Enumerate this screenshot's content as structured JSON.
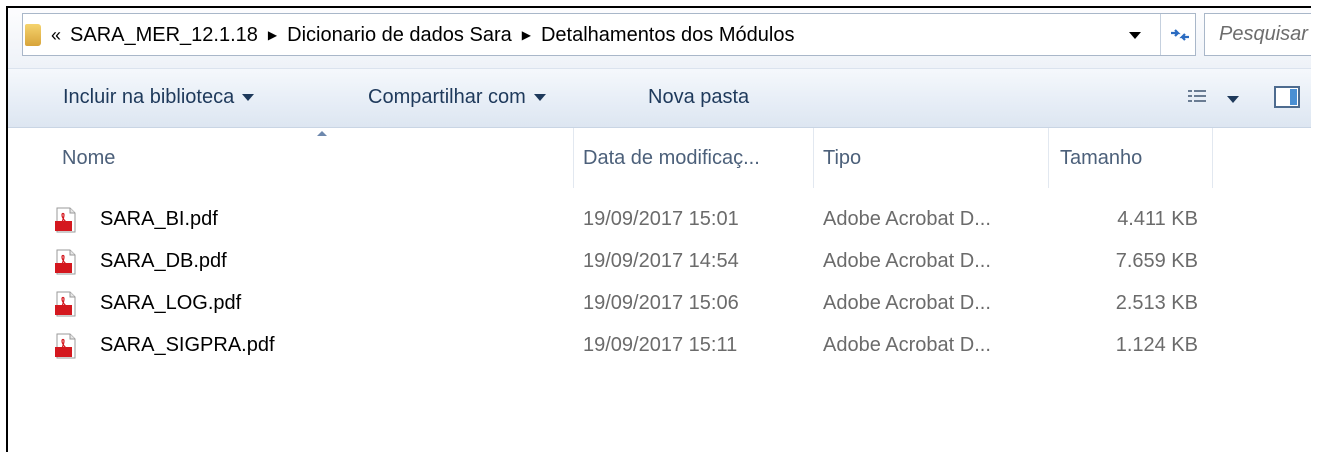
{
  "address_bar": {
    "overflow_chevron": "«",
    "breadcrumbs": [
      "SARA_MER_12.1.18",
      "Dicionario de dados Sara",
      "Detalhamentos dos Módulos"
    ],
    "search_placeholder": "Pesquisar"
  },
  "toolbar": {
    "include_label": "Incluir na biblioteca",
    "share_label": "Compartilhar com",
    "new_folder_label": "Nova pasta"
  },
  "columns": {
    "name": "Nome",
    "modified": "Data de modificaç...",
    "type": "Tipo",
    "size": "Tamanho"
  },
  "files": [
    {
      "name": "SARA_BI.pdf",
      "modified": "19/09/2017 15:01",
      "type": "Adobe Acrobat D...",
      "size": "4.411 KB",
      "icon": "pdf-icon"
    },
    {
      "name": "SARA_DB.pdf",
      "modified": "19/09/2017 14:54",
      "type": "Adobe Acrobat D...",
      "size": "7.659 KB",
      "icon": "pdf-icon"
    },
    {
      "name": "SARA_LOG.pdf",
      "modified": "19/09/2017 15:06",
      "type": "Adobe Acrobat D...",
      "size": "2.513 KB",
      "icon": "pdf-icon"
    },
    {
      "name": "SARA_SIGPRA.pdf",
      "modified": "19/09/2017 15:11",
      "type": "Adobe Acrobat D...",
      "size": "1.124 KB",
      "icon": "pdf-icon"
    }
  ],
  "colors": {
    "toolbar_text": "#1e395b",
    "header_text": "#4c607a",
    "pdf_red": "#d4181f"
  }
}
